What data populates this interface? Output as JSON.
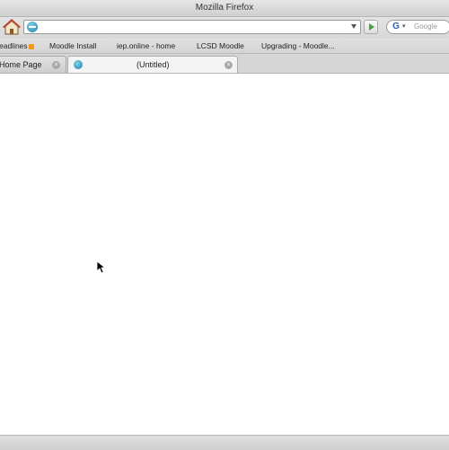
{
  "window": {
    "title": "Mozilla Firefox"
  },
  "toolbar": {
    "home_icon": "home-icon",
    "url_value": "",
    "go_icon": "go-arrow-icon",
    "search_engine": "G",
    "search_placeholder": "Google"
  },
  "bookmarks": [
    {
      "label": "eadlines",
      "icon": "rss-icon"
    },
    {
      "label": "Moodle Install"
    },
    {
      "label": "iep.online - home"
    },
    {
      "label": "LCSD Moodle"
    },
    {
      "label": "Upgrading - Moodle..."
    }
  ],
  "tabs": [
    {
      "label": "Home Page",
      "active": false
    },
    {
      "label": "(Untitled)",
      "active": true
    }
  ],
  "colors": {
    "chrome": "#d6d6d6",
    "content_bg": "#ffffff",
    "go_green": "#3aa53a"
  }
}
